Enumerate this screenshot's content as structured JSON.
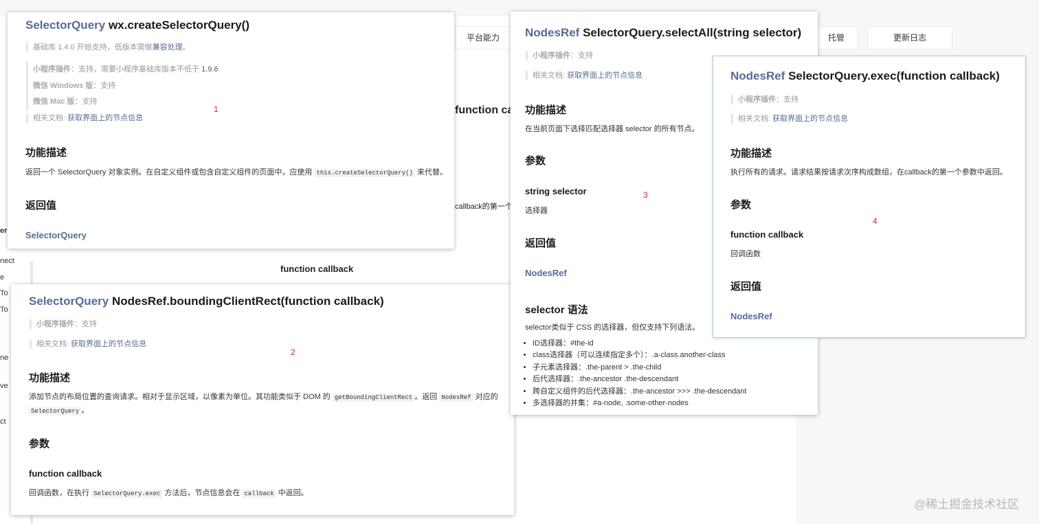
{
  "background": {
    "tabs": [
      "平台能力",
      "托管",
      "更新日志"
    ],
    "fragments": {
      "function_cal": "function cal",
      "callback_frag": "callback的第一个",
      "function_callback": "function callback",
      "side": [
        "er",
        "nect",
        "e",
        "To",
        "To",
        "ne",
        "ve",
        "ct"
      ]
    }
  },
  "card1": {
    "type_name": "SelectorQuery",
    "title_rest": " wx.createSelectorQuery()",
    "base_lib_prefix": "基础库 1.4.0 开始支持，低版本需做",
    "base_lib_link": "兼容处理",
    "base_lib_suffix": "。",
    "plugin_label": "小程序插件",
    "plugin_text": "：支持，需要小程序基础库版本不低于 ",
    "plugin_version": "1.9.6",
    "windows_label": "微信 Windows 版",
    "windows_text": "：支持",
    "mac_label": "微信 Mac 版",
    "mac_text": "：支持",
    "related_label": "相关文档: ",
    "related_link": "获取界面上的节点信息",
    "number": "1",
    "func_desc_heading": "功能描述",
    "func_desc_prefix": "返回一个 SelectorQuery 对象实例。在自定义组件或包含自定义组件的页面中，应使用 ",
    "func_desc_code": "this.createSelectorQuery()",
    "func_desc_suffix": " 来代替。",
    "return_heading": "返回值",
    "return_value": "SelectorQuery"
  },
  "card2": {
    "type_name": "SelectorQuery",
    "title_rest": " NodesRef.boundingClientRect(function callback)",
    "plugin_label": "小程序插件",
    "plugin_text": "：支持",
    "related_label": "相关文档: ",
    "related_link": "获取界面上的节点信息",
    "number": "2",
    "func_desc_heading": "功能描述",
    "desc_part1": "添加节点的布局位置的查询请求。相对于显示区域，以像素为单位。其功能类似于 DOM 的 ",
    "desc_code1": "getBoundingClientRect",
    "desc_part2": "。返回 ",
    "desc_code2": "NodesRef",
    "desc_part3": " 对应的",
    "desc_code3": "SelectorQuery",
    "desc_part4": "。",
    "params_heading": "参数",
    "param_name": "function callback",
    "param_desc_prefix": "回调函数，在执行 ",
    "param_desc_code1": "SelectorQuery.exec",
    "param_desc_mid": " 方法后，节点信息会在 ",
    "param_desc_code2": "callback",
    "param_desc_suffix": " 中返回。"
  },
  "card3": {
    "type_name": "NodesRef",
    "title_rest": " SelectorQuery.selectAll(string selector)",
    "plugin_label": "小程序插件",
    "plugin_text": "：支持",
    "related_label": "相关文档: ",
    "related_link": "获取界面上的节点信息",
    "number": "3",
    "func_desc_heading": "功能描述",
    "func_desc": "在当前页面下选择匹配选择器 selector 的所有节点。",
    "params_heading": "参数",
    "param_name": "string selector",
    "param_desc": "选择器",
    "return_heading": "返回值",
    "return_value": "NodesRef",
    "syntax_heading": "selector 语法",
    "syntax_desc": "selector类似于 CSS 的选择器，但仅支持下列语法。",
    "syntax_items": [
      "ID选择器：#the-id",
      "class选择器（可以连续指定多个）：.a-class.another-class",
      "子元素选择器：.the-parent > .the-child",
      "后代选择器：.the-ancestor .the-descendant",
      "跨自定义组件的后代选择器：.the-ancestor >>> .the-descendant",
      "多选择器的并集：#a-node, .some-other-nodes"
    ]
  },
  "card4": {
    "type_name": "NodesRef",
    "title_rest": " SelectorQuery.exec(function callback)",
    "plugin_label": "小程序插件",
    "plugin_text": "：支持",
    "related_label": "相关文档: ",
    "related_link": "获取界面上的节点信息",
    "number": "4",
    "func_desc_heading": "功能描述",
    "func_desc": "执行所有的请求。请求结果按请求次序构成数组，在callback的第一个参数中返回。",
    "params_heading": "参数",
    "param_name": "function callback",
    "param_desc": "回调函数",
    "return_heading": "返回值",
    "return_value": "NodesRef"
  },
  "watermark": "@稀土掘金技术社区",
  "colors": {
    "type_link": "#576b95",
    "number_red": "#e02020",
    "card_border_blue": "#a9c8ee"
  }
}
